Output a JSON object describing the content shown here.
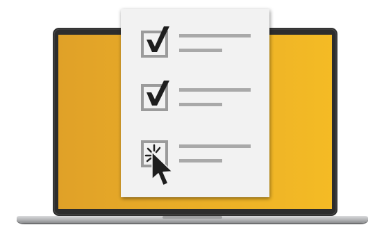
{
  "illustration": {
    "laptop": {
      "bezel_color": "#2d2d2d",
      "screen_colors": [
        "#e0a128",
        "#f4bb25"
      ],
      "base_color": "#c4c5c7",
      "base_shadow_color": "#8e8f91"
    },
    "checklist": {
      "paper_color": "#f2f2f2",
      "line_color": "#a9a9a9",
      "box_color": "#9b9b9b",
      "mark_color": "#1e1e1e",
      "items": [
        {
          "state": "checked",
          "icon": "checkmark-icon"
        },
        {
          "state": "checked",
          "icon": "checkmark-icon"
        },
        {
          "state": "clicking",
          "icon": "mouse-pointer-icon"
        }
      ]
    }
  }
}
